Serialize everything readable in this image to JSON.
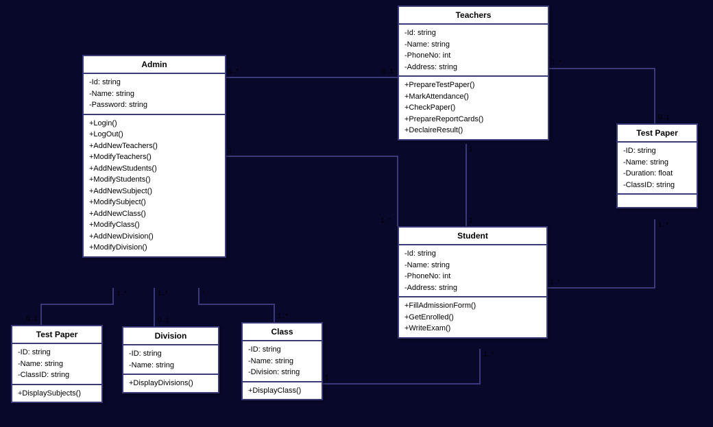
{
  "chart_data": {
    "type": "uml-class-diagram",
    "classes": [
      {
        "name": "Admin",
        "attributes": [
          "-Id: string",
          "-Name: string",
          "-Password: string"
        ],
        "methods": [
          "+Login()",
          "+LogOut()",
          "+AddNewTeachers()",
          "+ModifyTeachers()",
          "+AddNewStudents()",
          "+ModifyStudents()",
          "+AddNewSubject()",
          "+ModifySubject()",
          "+AddNewClass()",
          "+ModifyClass()",
          "+AddNewDivision()",
          "+ModifyDivision()"
        ]
      },
      {
        "name": "Teachers",
        "attributes": [
          "-Id: string",
          "-Name: string",
          "-PhoneNo: int",
          "-Address: string"
        ],
        "methods": [
          "+PrepareTestPaper()",
          "+MarkAttendance()",
          "+CheckPaper()",
          "+PrepareReportCards()",
          "+DeclaireResult()"
        ]
      },
      {
        "name": "Test Paper",
        "variant": "right",
        "attributes": [
          "-ID: string",
          "-Name: string",
          "-Duration: float",
          "-ClassID: string"
        ],
        "methods": []
      },
      {
        "name": "Student",
        "attributes": [
          "-Id: string",
          "-Name: string",
          "-PhoneNo: int",
          "-Address: string"
        ],
        "methods": [
          "+FillAdmissionForm()",
          "+GetEnrolled()",
          "+WriteExam()"
        ]
      },
      {
        "name": "Test Paper",
        "variant": "left",
        "attributes": [
          "-ID: string",
          "-Name: string",
          "-ClassID: string"
        ],
        "methods": [
          "+DisplaySubjects()"
        ]
      },
      {
        "name": "Division",
        "attributes": [
          "-ID: string",
          "-Name: string"
        ],
        "methods": [
          "+DisplayDivisions()"
        ]
      },
      {
        "name": "Class",
        "attributes": [
          "-ID: string",
          "-Name: string",
          "-Division: string"
        ],
        "methods": [
          "+DisplayClass()"
        ]
      }
    ],
    "associations": [
      {
        "from": "Admin",
        "to": "Teachers",
        "from_mult": "1..*",
        "to_mult": "0..1"
      },
      {
        "from": "Admin",
        "to": "Student",
        "from_mult": "1",
        "to_mult": "1..*"
      },
      {
        "from": "Admin",
        "to": "Test Paper (left)",
        "from_mult": "1..*",
        "to_mult": "0..1"
      },
      {
        "from": "Admin",
        "to": "Division",
        "from_mult": "1..*",
        "to_mult": "0..1"
      },
      {
        "from": "Admin",
        "to": "Class",
        "from_mult": "*",
        "to_mult": "1..*"
      },
      {
        "from": "Teachers",
        "to": "Test Paper (right)",
        "from_mult": "1..*",
        "to_mult": "0..1"
      },
      {
        "from": "Teachers",
        "to": "Student",
        "from_mult": "1",
        "to_mult": "1"
      },
      {
        "from": "Student",
        "to": "Test Paper (right)",
        "from_mult": "1..*",
        "to_mult": "1..*"
      },
      {
        "from": "Student",
        "to": "Class",
        "from_mult": "1..*",
        "to_mult": "1"
      }
    ]
  },
  "classes": {
    "admin": {
      "title": "Admin",
      "attrs": [
        "-Id: string",
        "-Name: string",
        "-Password: string"
      ],
      "methods": [
        "+Login()",
        "+LogOut()",
        "+AddNewTeachers()",
        "+ModifyTeachers()",
        "+AddNewStudents()",
        "+ModifyStudents()",
        "+AddNewSubject()",
        "+ModifySubject()",
        "+AddNewClass()",
        "+ModifyClass()",
        "+AddNewDivision()",
        "+ModifyDivision()"
      ]
    },
    "teachers": {
      "title": "Teachers",
      "attrs": [
        "-Id: string",
        "-Name: string",
        "-PhoneNo: int",
        "-Address: string"
      ],
      "methods": [
        "+PrepareTestPaper()",
        "+MarkAttendance()",
        "+CheckPaper()",
        "+PrepareReportCards()",
        "+DeclaireResult()"
      ]
    },
    "testpaper_r": {
      "title": "Test Paper",
      "attrs": [
        "-ID: string",
        "-Name: string",
        "-Duration: float",
        "-ClassID: string"
      ],
      "methods": []
    },
    "student": {
      "title": "Student",
      "attrs": [
        "-Id: string",
        "-Name: string",
        "-PhoneNo: int",
        "-Address: string"
      ],
      "methods": [
        "+FillAdmissionForm()",
        "+GetEnrolled()",
        "+WriteExam()"
      ]
    },
    "testpaper_l": {
      "title": "Test Paper",
      "attrs": [
        "-ID: string",
        "-Name: string",
        "-ClassID: string"
      ],
      "methods": [
        "+DisplaySubjects()"
      ]
    },
    "division": {
      "title": "Division",
      "attrs": [
        "-ID: string",
        "-Name: string"
      ],
      "methods": [
        "+DisplayDivisions()"
      ]
    },
    "cls": {
      "title": "Class",
      "attrs": [
        "-ID: string",
        "-Name: string",
        "-Division: string"
      ],
      "methods": [
        "+DisplayClass()"
      ]
    }
  },
  "mult": {
    "admin_teachers_l": "1..*",
    "admin_teachers_r": "0..1",
    "admin_student_l": "1",
    "admin_student_r": "1..*",
    "admin_tp_l_top": "1..*",
    "admin_tp_l_bot": "0..1",
    "admin_div_top": "1..*",
    "admin_div_bot": "0..1",
    "admin_cls_top": "*",
    "admin_cls_bot": "1..*",
    "teachers_tp_r_l": "1..*",
    "teachers_tp_r_r": "0..1",
    "teachers_student_t": "1",
    "teachers_student_b": "1",
    "student_tp_r_l": "1..*",
    "student_tp_r_r": "1..*",
    "student_cls_l": "1",
    "student_cls_r": "1..*"
  }
}
